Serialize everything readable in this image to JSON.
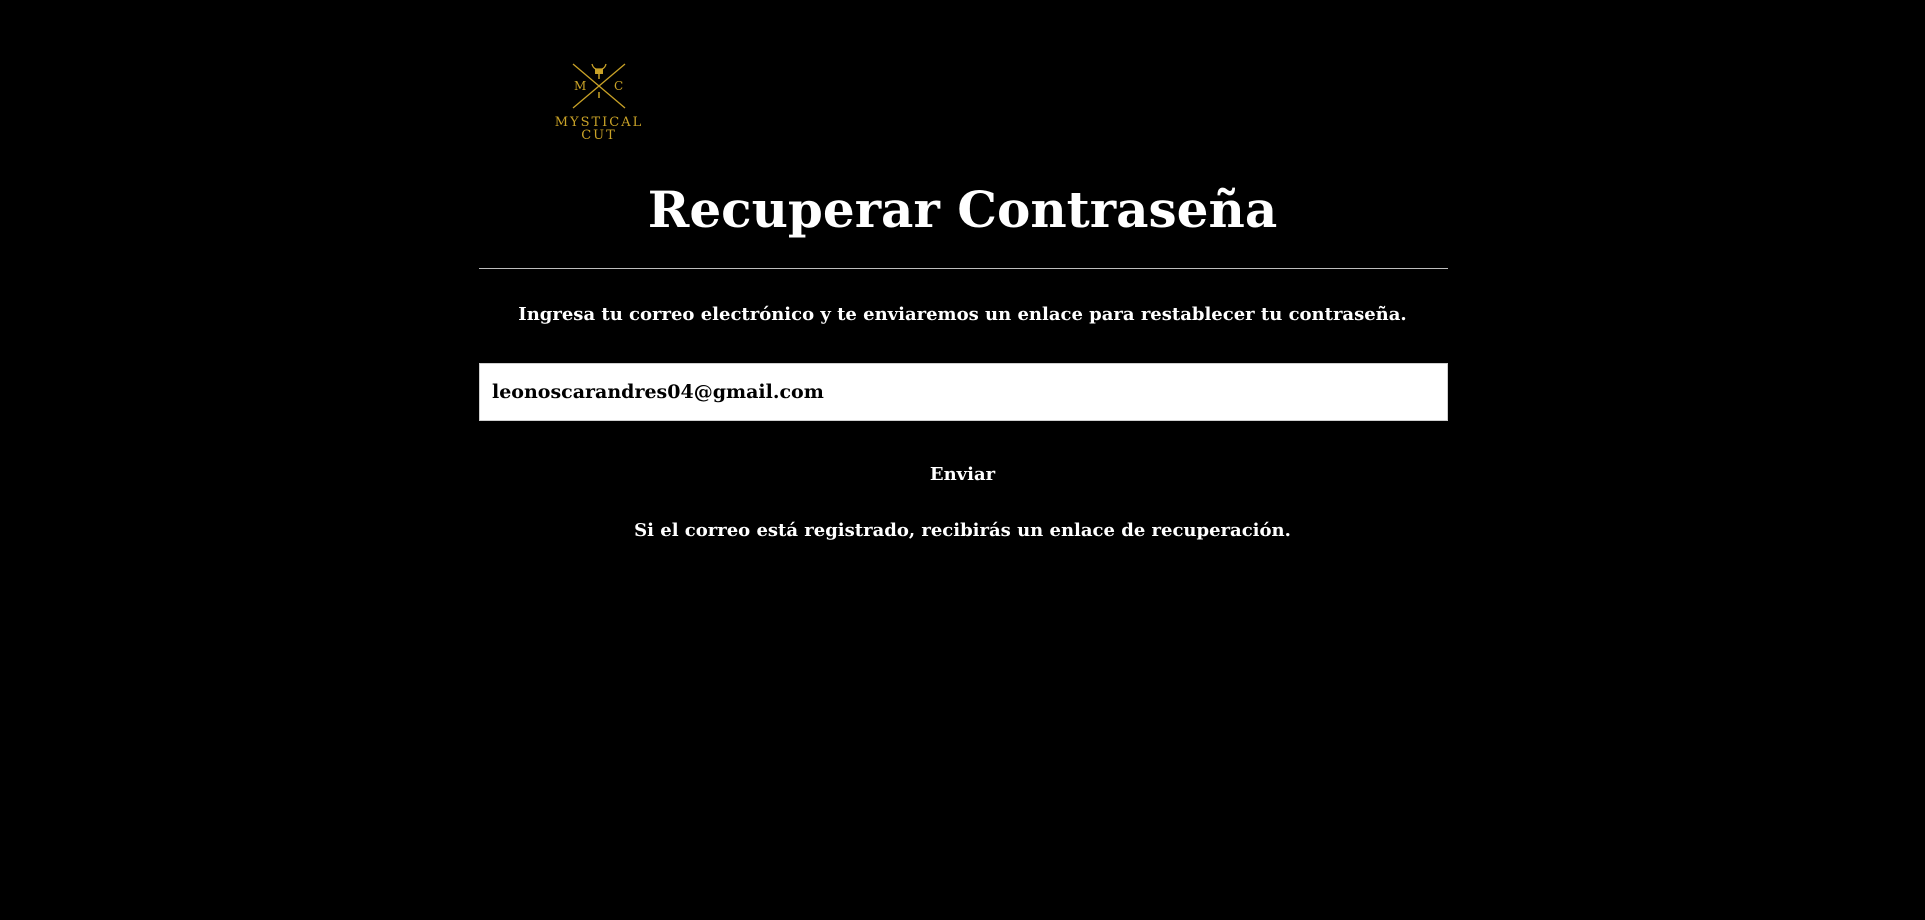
{
  "brand": {
    "logo_line1": "MYSTICAL",
    "logo_line2": "CUT",
    "logo_left_letter": "M",
    "logo_right_letter": "C",
    "logo_color": "#c9a227",
    "logo_icon": "bull-skull-crossed-swords-icon"
  },
  "page": {
    "title": "Recuperar Contraseña",
    "instructions": "Ingresa tu correo electrónico y te enviaremos un enlace para restablecer tu contraseña.",
    "background_color": "#000000",
    "text_color": "#ffffff"
  },
  "form": {
    "email_value": "leonoscarandres04@gmail.com",
    "submit_label": "Enviar"
  },
  "status": {
    "message": "Si el correo está registrado, recibirás un enlace de recuperación."
  }
}
